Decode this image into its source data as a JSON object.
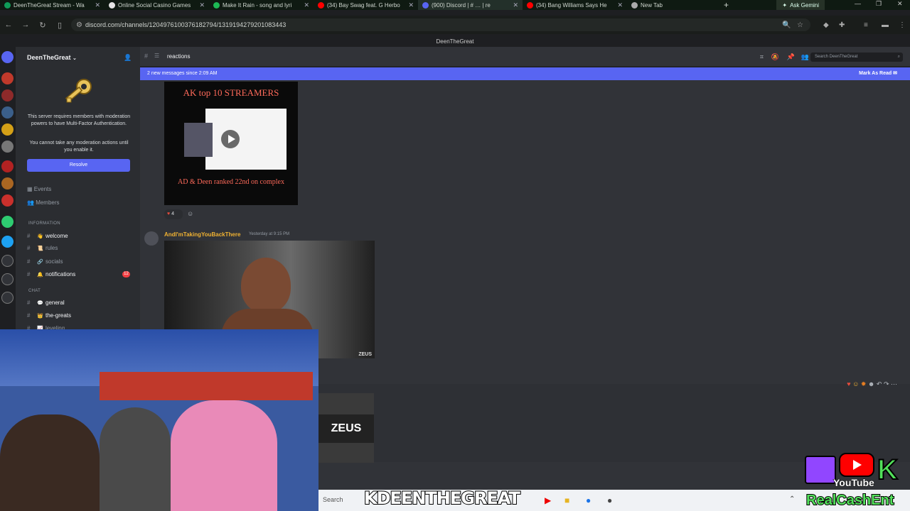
{
  "browser": {
    "tabs": [
      {
        "label": "DeenTheGreat Stream - Wa",
        "icon_color": "#0f9d58",
        "active": false
      },
      {
        "label": "Online Social Casino Games",
        "icon_color": "#e5e5e5",
        "active": false
      },
      {
        "label": "Make It Rain - song and lyri",
        "icon_color": "#1db954",
        "active": false
      },
      {
        "label": "(34) Bay Swag feat. G Herbo",
        "icon_color": "#ff0000",
        "active": false
      },
      {
        "label": "(900) Discord | # … | re",
        "icon_color": "#5865f2",
        "active": true
      },
      {
        "label": "(34) Bang Williams Says He",
        "icon_color": "#ff0000",
        "active": false
      },
      {
        "label": "New Tab",
        "icon_color": "#aaaaaa",
        "active": false
      }
    ],
    "ask_gemini": "Ask Gemini",
    "url": "discord.com/channels/1204976100376182794/1319194279201083443"
  },
  "discord": {
    "window_title": "DeenTheGreat",
    "server_name": "DeenTheGreat",
    "mfa_notice": "This server requires members with moderation powers to have Multi-Factor Authentication.",
    "mfa_sub": "You cannot take any moderation actions until you enable it.",
    "resolve_label": "Resolve",
    "events_label": "Events",
    "members_label": "Members",
    "category_information": "INFORMATION",
    "category_chat": "CHAT",
    "channels": [
      {
        "name": "welcome",
        "emoji": "👋"
      },
      {
        "name": "rules",
        "emoji": "📜"
      },
      {
        "name": "socials",
        "emoji": "🔗"
      },
      {
        "name": "notifications",
        "emoji": "🔔"
      },
      {
        "name": "general",
        "emoji": "💬"
      },
      {
        "name": "the-greats",
        "emoji": "👑"
      },
      {
        "name": "leveling",
        "emoji": "📈"
      }
    ],
    "notifications_badge": "12",
    "channel_title": "reactions",
    "search_placeholder": "Search DeenTheGreat",
    "new_messages_banner": "2 new messages since 2:09 AM",
    "mark_as_read": "Mark As Read",
    "thumb1_title": "AK top 10 STREAMERS",
    "thumb1_subtitle": "AD & Deen ranked 22nd on complex",
    "reaction_count": "4",
    "author": "AndI'mTakingYouBackThere",
    "timestamp": "Yesterday at 9:15 PM",
    "video_logo": "ZEUS",
    "zeus_text": "ZEUS"
  },
  "stream_overlay": {
    "ticker": "KDEENTHEGREAT",
    "taskbar_search": "Search",
    "brand_youtube": "YouTube",
    "brand_ent": "RealCashEnt"
  },
  "colors": {
    "blurple": "#5865f2",
    "author_gold": "#f0b232",
    "brand_green": "#52e05a"
  }
}
